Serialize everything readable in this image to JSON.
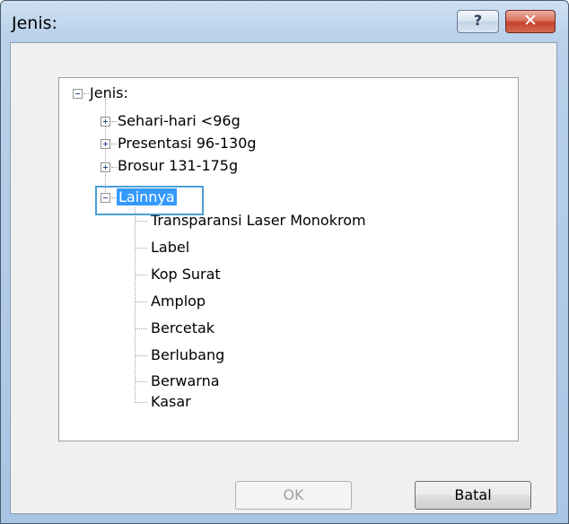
{
  "window": {
    "title": "Jenis:",
    "help_label": "?",
    "close_label": "✕"
  },
  "tree": {
    "root": "Jenis:",
    "categories": [
      {
        "label": "Sehari-hari <96g",
        "expanded": false
      },
      {
        "label": "Presentasi 96-130g",
        "expanded": false
      },
      {
        "label": "Brosur 131-175g",
        "expanded": false
      },
      {
        "label": "Lainnya",
        "expanded": true,
        "selected": true
      }
    ],
    "lainnya_items": [
      "Transparansi Laser Monokrom",
      "Label",
      "Kop Surat",
      "Amplop",
      "Bercetak",
      "Berlubang",
      "Berwarna",
      "Kasar"
    ]
  },
  "buttons": {
    "ok_label": "OK",
    "ok_enabled": false,
    "cancel_label": "Batal"
  },
  "colors": {
    "selection": "#3399ff",
    "highlight_frame": "#4a9fd8",
    "close_button": "#c5402a"
  }
}
